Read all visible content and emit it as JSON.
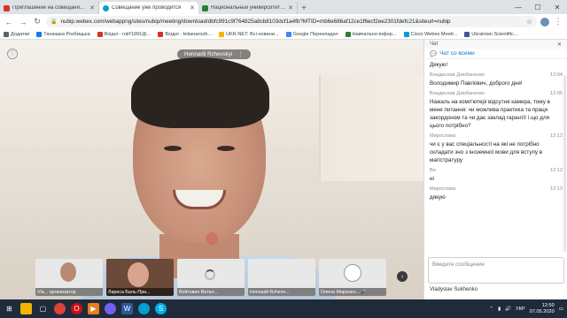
{
  "browser": {
    "tabs": [
      {
        "title": "Приглашение на совещание Х",
        "color": "#d93025"
      },
      {
        "title": "Совещание уже проводится",
        "color": "#00a0d1",
        "active": true
      },
      {
        "title": "Национальный университет био",
        "color": "#2e7d32"
      }
    ],
    "new_tab": "+",
    "url": "nubip.webex.com/webappng/sites/nubip/meeting/download/dbfc991c9f764825a8cb8103dcf1a4fb?MTID=mb6e686af12ce1f6ecf2ee2301fdefc21&siteurl=nubip",
    "bookmarks": [
      {
        "label": "Додатки",
        "color": "#5f6368"
      },
      {
        "label": "Танюшка Розбицька",
        "color": "#1877f2"
      },
      {
        "label": "Вхідні - roirf1991@...",
        "color": "#d93025"
      },
      {
        "label": "Вхідні - tetianarozb...",
        "color": "#d93025"
      },
      {
        "label": "UKR.NET: Всі новини...",
        "color": "#f4b400"
      },
      {
        "label": "Google Перекладач",
        "color": "#4285f4"
      },
      {
        "label": "Навчально-інфор...",
        "color": "#2e7d32"
      },
      {
        "label": "Cisco Webex Meeti...",
        "color": "#00a0d1"
      },
      {
        "label": "Ukrainian Scientific...",
        "color": "#3b5998"
      }
    ]
  },
  "meeting": {
    "active_speaker": "Hennadii Rzhevskyi",
    "thumbnails": [
      {
        "name": "Vla...",
        "role": "организатор"
      },
      {
        "name": "Лариса Баль-При..."
      },
      {
        "name": "Войтович Витал..."
      },
      {
        "name": "Hennadii Rzheve..."
      },
      {
        "name": "Олена Миронен..."
      }
    ]
  },
  "chat": {
    "header": "Чат",
    "scope": "Чат со всеми",
    "messages": [
      {
        "author": "",
        "time": "",
        "text": "Дякую!"
      },
      {
        "author": "Владислав Дзюбаненко",
        "time": "12:04",
        "text": "Володимир Павлович, доброго дня!"
      },
      {
        "author": "Владислав Дзюбаненко",
        "time": "12:05",
        "text": "Нажаль на комп'ютері відсутня камера, тому в мене питання: чи можлива практика та праця закордоном та чи дає заклад гарантії і що для цього потрібно?"
      },
      {
        "author": "Мирослава",
        "time": "12:12",
        "text": "чи є у вас спеціальності на які не потрібно складати зно з іноземної мови для вступу в магістратуру"
      },
      {
        "author": "Ви",
        "time": "12:12",
        "text": "ні"
      },
      {
        "author": "Мирослава",
        "time": "12:13",
        "text": "дякую"
      }
    ],
    "compose_placeholder": "Введите сообщение",
    "sender": "Vladyslav Sukhenko"
  },
  "taskbar": {
    "lang": "УКР",
    "time": "12:50",
    "date": "07.05.2020"
  }
}
